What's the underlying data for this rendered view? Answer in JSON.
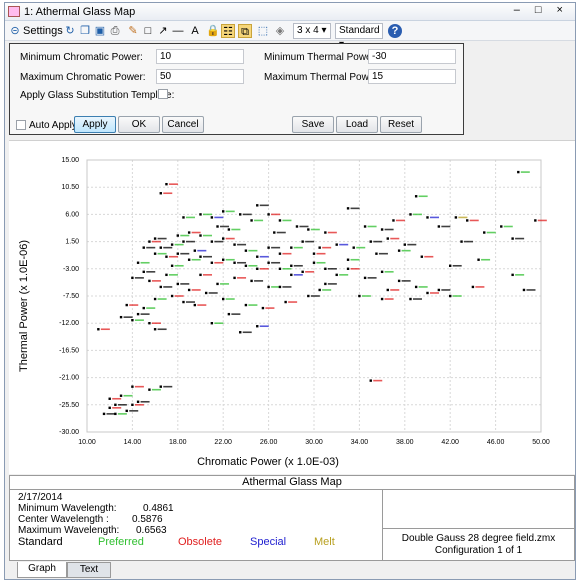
{
  "window": {
    "title": "1: Athermal Glass Map",
    "controls": "– □ ×"
  },
  "toolbar": {
    "settings_label": "Settings",
    "grid_select": "3 x 4",
    "style_select": "Standard"
  },
  "settings": {
    "min_chromatic_label": "Minimum Chromatic Power:",
    "min_chromatic_value": "10",
    "max_chromatic_label": "Maximum Chromatic Power:",
    "max_chromatic_value": "50",
    "min_thermal_label": "Minimum Thermal Power:",
    "min_thermal_value": "-30",
    "max_thermal_label": "Maximum Thermal Power:",
    "max_thermal_value": "15",
    "substitution_label": "Apply Glass Substitution Template:",
    "auto_apply_label": "Auto Apply",
    "apply_label": "Apply",
    "ok_label": "OK",
    "cancel_label": "Cancel",
    "save_label": "Save",
    "load_label": "Load",
    "reset_label": "Reset"
  },
  "info": {
    "title": "Athermal Glass Map",
    "date": "2/17/2014",
    "min_wl_label": "Minimum Wavelength:",
    "min_wl_value": "0.4861",
    "center_wl_label": "Center Wavelength :",
    "center_wl_value": "0.5876",
    "max_wl_label": "Maximum Wavelength:",
    "max_wl_value": "0.6563",
    "legend": [
      "Standard",
      "Preferred",
      "Obsolete",
      "Special",
      "Melt"
    ],
    "legend_colors": [
      "#000000",
      "#2fbf2f",
      "#e02020",
      "#2020d0",
      "#b8a020"
    ],
    "file": "Double Gauss 28 degree field.zmx",
    "config": "Configuration 1 of 1"
  },
  "tabs": [
    "Graph",
    "Text"
  ],
  "chart_data": {
    "type": "scatter",
    "xlabel": "Chromatic Power (x 1.0E-03)",
    "ylabel": "Thermal Power (x 1.0E-06)",
    "xlim": [
      10,
      50
    ],
    "ylim": [
      -30,
      15
    ],
    "xticks": [
      "10.00",
      "14.00",
      "18.00",
      "22.00",
      "26.00",
      "30.00",
      "34.00",
      "38.00",
      "42.00",
      "46.00",
      "50.00"
    ],
    "yticks": [
      "15.00",
      "10.50",
      "6.00",
      "1.50",
      "-3.00",
      "-7.50",
      "-12.00",
      "-16.50",
      "-21.00",
      "-25.50",
      "-30.00"
    ],
    "point_color_keys": [
      "Standard",
      "Preferred",
      "Obsolete",
      "Special",
      "Melt"
    ],
    "points": [
      [
        16.5,
        9.5,
        2
      ],
      [
        17.0,
        11.0,
        2
      ],
      [
        18.5,
        5.5,
        1
      ],
      [
        20.0,
        6.0,
        1
      ],
      [
        21.0,
        5.5,
        3
      ],
      [
        22.0,
        6.5,
        1
      ],
      [
        23.5,
        6.0,
        0
      ],
      [
        24.5,
        5.0,
        1
      ],
      [
        25.0,
        7.5,
        0
      ],
      [
        26.0,
        6.0,
        2
      ],
      [
        27.0,
        5.0,
        1
      ],
      [
        28.5,
        4.0,
        0
      ],
      [
        29.5,
        3.5,
        1
      ],
      [
        31.0,
        3.0,
        2
      ],
      [
        33.0,
        7.0,
        0
      ],
      [
        34.5,
        4.0,
        1
      ],
      [
        36.0,
        3.5,
        0
      ],
      [
        37.0,
        5.0,
        2
      ],
      [
        38.5,
        6.0,
        1
      ],
      [
        39.0,
        9.0,
        1
      ],
      [
        40.0,
        5.5,
        3
      ],
      [
        41.0,
        4.0,
        0
      ],
      [
        42.5,
        5.5,
        4
      ],
      [
        43.5,
        5.0,
        2
      ],
      [
        46.5,
        4.0,
        1
      ],
      [
        48.0,
        13.0,
        1
      ],
      [
        49.5,
        5.0,
        2
      ],
      [
        47.5,
        2.0,
        0
      ],
      [
        45.0,
        3.0,
        1
      ],
      [
        43.0,
        1.5,
        0
      ],
      [
        38.0,
        1.0,
        0
      ],
      [
        36.5,
        2.0,
        2
      ],
      [
        35.0,
        1.5,
        0
      ],
      [
        33.5,
        0.5,
        1
      ],
      [
        32.0,
        1.0,
        3
      ],
      [
        30.5,
        0.5,
        2
      ],
      [
        29.0,
        1.5,
        0
      ],
      [
        28.0,
        0.5,
        1
      ],
      [
        27.0,
        -0.5,
        2
      ],
      [
        26.0,
        0.5,
        0
      ],
      [
        25.0,
        -1.0,
        3
      ],
      [
        24.0,
        0.0,
        1
      ],
      [
        23.0,
        1.0,
        0
      ],
      [
        22.0,
        2.0,
        2
      ],
      [
        21.0,
        1.5,
        0
      ],
      [
        20.0,
        2.5,
        1
      ],
      [
        19.0,
        3.0,
        2
      ],
      [
        18.5,
        1.5,
        0
      ],
      [
        17.5,
        1.0,
        1
      ],
      [
        16.5,
        0.5,
        0
      ],
      [
        15.5,
        1.5,
        2
      ],
      [
        15.0,
        0.5,
        0
      ],
      [
        16.0,
        -0.5,
        1
      ],
      [
        17.0,
        -1.0,
        2
      ],
      [
        18.0,
        -0.5,
        0
      ],
      [
        19.0,
        -1.5,
        1
      ],
      [
        20.0,
        -1.0,
        0
      ],
      [
        21.0,
        -2.0,
        2
      ],
      [
        22.0,
        -1.5,
        1
      ],
      [
        23.0,
        -2.0,
        0
      ],
      [
        24.0,
        -2.5,
        1
      ],
      [
        25.0,
        -3.0,
        2
      ],
      [
        26.0,
        -2.0,
        0
      ],
      [
        27.0,
        -3.0,
        1
      ],
      [
        28.0,
        -2.5,
        0
      ],
      [
        29.0,
        -3.5,
        2
      ],
      [
        30.0,
        -2.0,
        1
      ],
      [
        31.0,
        -3.0,
        0
      ],
      [
        32.0,
        -4.0,
        1
      ],
      [
        33.0,
        -3.0,
        2
      ],
      [
        34.5,
        -4.5,
        0
      ],
      [
        36.0,
        -3.5,
        1
      ],
      [
        37.5,
        -5.0,
        0
      ],
      [
        39.0,
        -6.0,
        1
      ],
      [
        40.0,
        -7.0,
        2
      ],
      [
        41.0,
        -6.5,
        0
      ],
      [
        42.0,
        -7.5,
        1
      ],
      [
        44.0,
        -6.0,
        2
      ],
      [
        47.5,
        -4.0,
        1
      ],
      [
        48.5,
        -6.5,
        0
      ],
      [
        38.5,
        -8.0,
        0
      ],
      [
        36.0,
        -8.0,
        2
      ],
      [
        34.0,
        -7.5,
        1
      ],
      [
        31.0,
        -5.5,
        0
      ],
      [
        29.5,
        -7.5,
        0
      ],
      [
        27.5,
        -8.5,
        2
      ],
      [
        26.0,
        -6.0,
        1
      ],
      [
        24.5,
        -5.0,
        0
      ],
      [
        23.0,
        -4.5,
        2
      ],
      [
        21.5,
        -5.5,
        1
      ],
      [
        20.5,
        -7.0,
        0
      ],
      [
        19.0,
        -6.5,
        2
      ],
      [
        18.0,
        -5.5,
        0
      ],
      [
        17.0,
        -4.0,
        1
      ],
      [
        16.5,
        -6.0,
        0
      ],
      [
        15.5,
        -5.0,
        2
      ],
      [
        15.0,
        -3.5,
        0
      ],
      [
        14.5,
        -2.0,
        1
      ],
      [
        14.0,
        -4.5,
        0
      ],
      [
        16.0,
        -8.0,
        1
      ],
      [
        17.5,
        -7.5,
        2
      ],
      [
        18.5,
        -8.5,
        0
      ],
      [
        19.5,
        -9.0,
        2
      ],
      [
        15.0,
        -9.5,
        1
      ],
      [
        14.5,
        -10.5,
        0
      ],
      [
        13.5,
        -9.0,
        2
      ],
      [
        13.0,
        -11.0,
        0
      ],
      [
        14.0,
        -11.5,
        1
      ],
      [
        15.5,
        -12.0,
        2
      ],
      [
        16.0,
        -13.0,
        0
      ],
      [
        11.0,
        -13.0,
        2
      ],
      [
        21.0,
        -12.0,
        1
      ],
      [
        22.5,
        -10.5,
        0
      ],
      [
        25.0,
        -12.5,
        3
      ],
      [
        23.5,
        -13.5,
        0
      ],
      [
        35.0,
        -21.5,
        2
      ],
      [
        14.0,
        -22.5,
        2
      ],
      [
        15.5,
        -23.0,
        1
      ],
      [
        16.5,
        -22.5,
        0
      ],
      [
        12.0,
        -24.5,
        2
      ],
      [
        12.5,
        -25.5,
        0
      ],
      [
        13.0,
        -24.0,
        1
      ],
      [
        14.0,
        -25.5,
        2
      ],
      [
        13.5,
        -26.5,
        0
      ],
      [
        12.5,
        -27.0,
        1
      ],
      [
        11.5,
        -27.0,
        0
      ],
      [
        12.0,
        -26.0,
        2
      ],
      [
        14.5,
        -25.0,
        0
      ],
      [
        24.0,
        -9.0,
        1
      ],
      [
        28.0,
        -4.0,
        3
      ],
      [
        22.5,
        3.5,
        1
      ],
      [
        26.5,
        3.0,
        0
      ],
      [
        30.0,
        -0.5,
        2
      ],
      [
        19.5,
        0.0,
        3
      ],
      [
        17.5,
        -2.5,
        1
      ],
      [
        16.0,
        2.0,
        0
      ],
      [
        33.0,
        -1.5,
        1
      ],
      [
        35.5,
        -0.5,
        0
      ],
      [
        37.5,
        0.0,
        1
      ],
      [
        39.5,
        -1.0,
        2
      ],
      [
        42.0,
        -2.5,
        0
      ],
      [
        44.5,
        -1.5,
        1
      ],
      [
        36.5,
        -6.5,
        2
      ],
      [
        30.5,
        -6.5,
        1
      ],
      [
        27.0,
        -6.0,
        0
      ],
      [
        25.5,
        -9.5,
        2
      ],
      [
        22.0,
        -8.0,
        1
      ],
      [
        20.0,
        -4.0,
        2
      ],
      [
        18.0,
        2.5,
        1
      ],
      [
        21.5,
        4.0,
        0
      ]
    ]
  }
}
